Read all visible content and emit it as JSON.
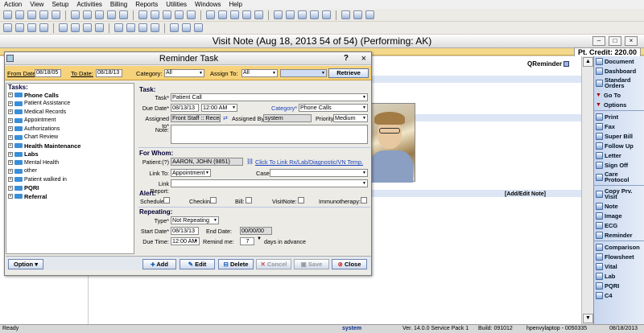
{
  "menu": [
    "Action",
    "View",
    "Setup",
    "Activities",
    "Billing",
    "Reports",
    "Utilities",
    "Windows",
    "Help"
  ],
  "visit_note": {
    "title": "Visit Note (Aug 18, 2013   54 of 54) (Performing: AK)",
    "credit": "Pt. Credit: 220.00",
    "qreminder": "QReminder",
    "add_edit_note": "[Add/Edit Note]"
  },
  "right_sidebar": {
    "items": [
      "Document",
      "Dashboard",
      "Standard Orders",
      "Go To",
      "Options",
      "Print",
      "Fax",
      "Super Bill",
      "Follow Up",
      "Letter",
      "Sign Off",
      "Care Protocol",
      "Copy Prv. Visit",
      "Note",
      "Image",
      "ECG",
      "Reminder",
      "Comparison",
      "Flowsheet",
      "Vital",
      "Lab",
      "PQRI",
      "C4"
    ]
  },
  "status_bar": {
    "left": "Ready",
    "user": "system",
    "version": "Ver. 14.0.0 Service Pack 1",
    "build": "Build: 091012",
    "machine": "hpenvylaptop - 0050335",
    "date": "08/18/2013"
  },
  "dialog": {
    "title": "Reminder Task",
    "help": "?",
    "close": "×",
    "filter": {
      "from_label": "From Date:",
      "from_value": "08/18/05",
      "to_label": "To Date:",
      "to_value": "08/18/13",
      "category_label": "Category:",
      "category_value": "All",
      "assign_label": "Assign To:",
      "assign_value": "All",
      "retrieve": "Retrieve"
    },
    "tasks": {
      "header": "Tasks:",
      "items": [
        {
          "label": "Phone Calls",
          "bold": true
        },
        {
          "label": "Patient Assistance"
        },
        {
          "label": "Medical Records"
        },
        {
          "label": "Appointment"
        },
        {
          "label": "Authorizations"
        },
        {
          "label": "Chart Review"
        },
        {
          "label": "Health Maintenance",
          "bold": true
        },
        {
          "label": "Labs",
          "bold": true
        },
        {
          "label": "Mental Health"
        },
        {
          "label": "other"
        },
        {
          "label": "Patient walked in"
        },
        {
          "label": "PQRI",
          "bold": true
        },
        {
          "label": "Referral",
          "bold": true
        }
      ]
    },
    "task_section": {
      "header": "Task:",
      "task_label": "Task*",
      "task_value": "Patient Call",
      "due_label": "Due Date*",
      "due_date": "08/13/13",
      "due_time": "12:00 AM",
      "category_label": "Category*",
      "category_value": "Phone Calls",
      "assigned_to_label": "Assigned to*",
      "assigned_to_value": "Front Staff :: Recept",
      "assigned_by_label": "Assigned By:",
      "assigned_by_value": "system",
      "priority_label": "Priority:",
      "priority_value": "Medium",
      "note_label": "Note:"
    },
    "for_whom": {
      "header": "For Whom:",
      "patient_label": "Patient:(?)",
      "patient_value": "AARON, JOHN  (9851)",
      "link_text": "Click To Link Rx/Lab/Diagnostic/VN Temp.",
      "link_to_label": "Link To:",
      "link_to_value": "Appointment",
      "case_label": "Case:",
      "link_report_label": "Link Report:"
    },
    "alert": {
      "header": "Alert:",
      "schedule": "Schedule:",
      "checkin": "Checkin:",
      "bill": "Bill:",
      "visitnote": "VisitNote:",
      "immunotherapy": "Immunotherapy:"
    },
    "repeating": {
      "header": "Repeating:",
      "type_label": "Type*",
      "type_value": "Not Repeating",
      "start_label": "Start Date*",
      "start_value": "08/13/13",
      "end_label": "End Date:",
      "end_value": "00/00/00",
      "due_time_label": "Due Time:",
      "due_time_value": "12:00 AM",
      "remind_label": "Remind me:",
      "remind_value": "7",
      "days_text": "days in advance"
    },
    "buttons": {
      "option": "Option",
      "add": "Add",
      "edit": "Edit",
      "delete": "Delete",
      "cancel": "Cancel",
      "save": "Save",
      "close": "Close"
    }
  }
}
